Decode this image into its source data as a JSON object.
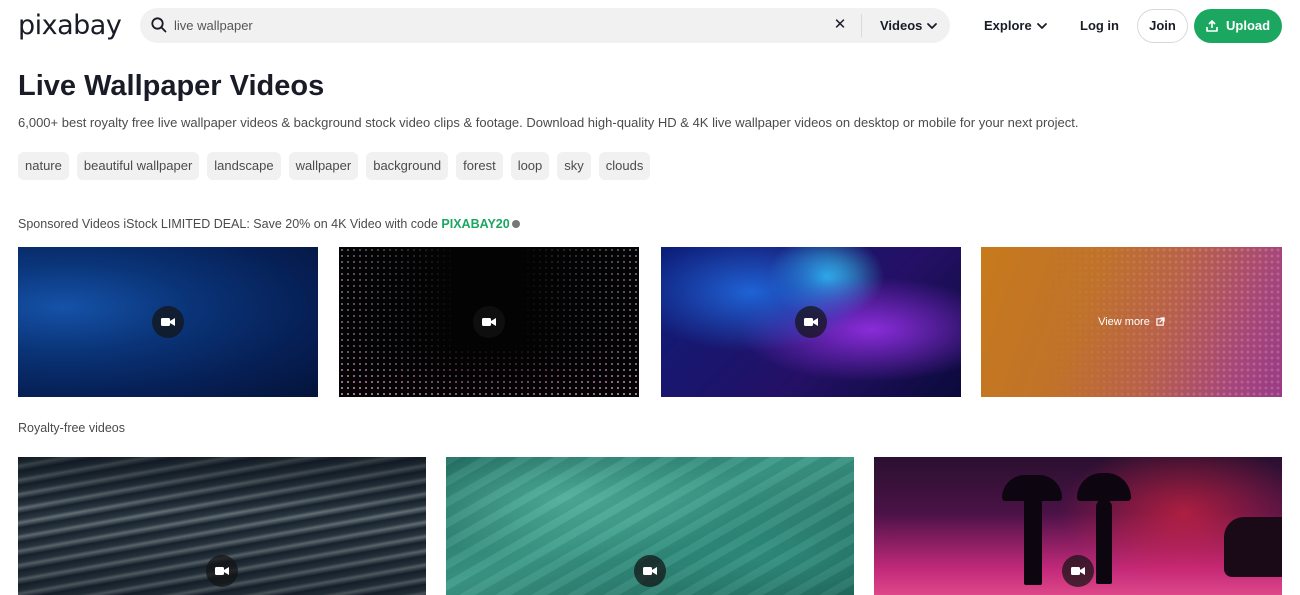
{
  "header": {
    "logo": "pixabay",
    "search": {
      "value": "live wallpaper",
      "type_label": "Videos"
    },
    "nav": {
      "explore": "Explore",
      "login": "Log in"
    },
    "join_label": "Join",
    "upload_label": "Upload",
    "accent_color": "#1ba760"
  },
  "page": {
    "title": "Live Wallpaper Videos",
    "description": "6,000+ best royalty free live wallpaper videos & background stock video clips & footage. Download high-quality HD & 4K live wallpaper videos on desktop or mobile for your next project."
  },
  "tags": [
    "nature",
    "beautiful wallpaper",
    "landscape",
    "wallpaper",
    "background",
    "forest",
    "loop",
    "sky",
    "clouds"
  ],
  "sponsored": {
    "text": "Sponsored Videos iStock LIMITED DEAL: Save 20% on 4K Video with code ",
    "code": "PIXABAY20",
    "view_more": "View more"
  },
  "royalty": {
    "label": "Royalty-free videos"
  },
  "icons": {
    "search": "search-icon",
    "clear": "close-icon",
    "chevron": "chevron-down-icon",
    "upload": "upload-icon",
    "video": "video-camera-icon",
    "info": "info-icon",
    "external": "external-link-icon"
  }
}
